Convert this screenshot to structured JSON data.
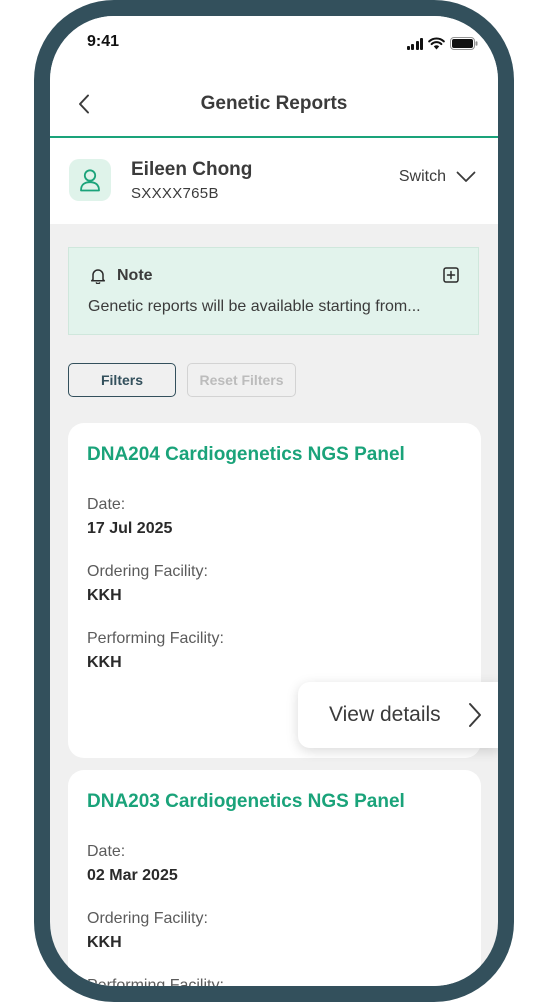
{
  "status_bar": {
    "time": "9:41"
  },
  "header": {
    "title": "Genetic Reports"
  },
  "profile": {
    "name": "Eileen Chong",
    "id": "SXXXX765B",
    "switch_label": "Switch"
  },
  "note": {
    "title": "Note",
    "text": "Genetic reports will be available starting from..."
  },
  "filters": {
    "filters_label": "Filters",
    "reset_label": "Reset Filters"
  },
  "reports": [
    {
      "title": "DNA204 Cardiogenetics NGS Panel",
      "date_label": "Date:",
      "date": "17 Jul 2025",
      "ordering_label": "Ordering Facility:",
      "ordering": "KKH",
      "performing_label": "Performing Facility:",
      "performing": "KKH"
    },
    {
      "title": "DNA203 Cardiogenetics NGS Panel",
      "date_label": "Date:",
      "date": "02 Mar 2025",
      "ordering_label": "Ordering Facility:",
      "ordering": "KKH",
      "performing_label": "Performing Facility:"
    }
  ],
  "view_details": {
    "label": "View details"
  },
  "colors": {
    "accent": "#1aa37a",
    "frame": "#33505c",
    "note_bg": "#e2f3ec",
    "background": "#f0f0f0"
  },
  "icons": [
    "back-chevron-icon",
    "user-icon",
    "chevron-down-icon",
    "bell-icon",
    "expand-plus-icon",
    "chevron-right-icon",
    "signal-icon",
    "wifi-icon",
    "battery-icon"
  ]
}
